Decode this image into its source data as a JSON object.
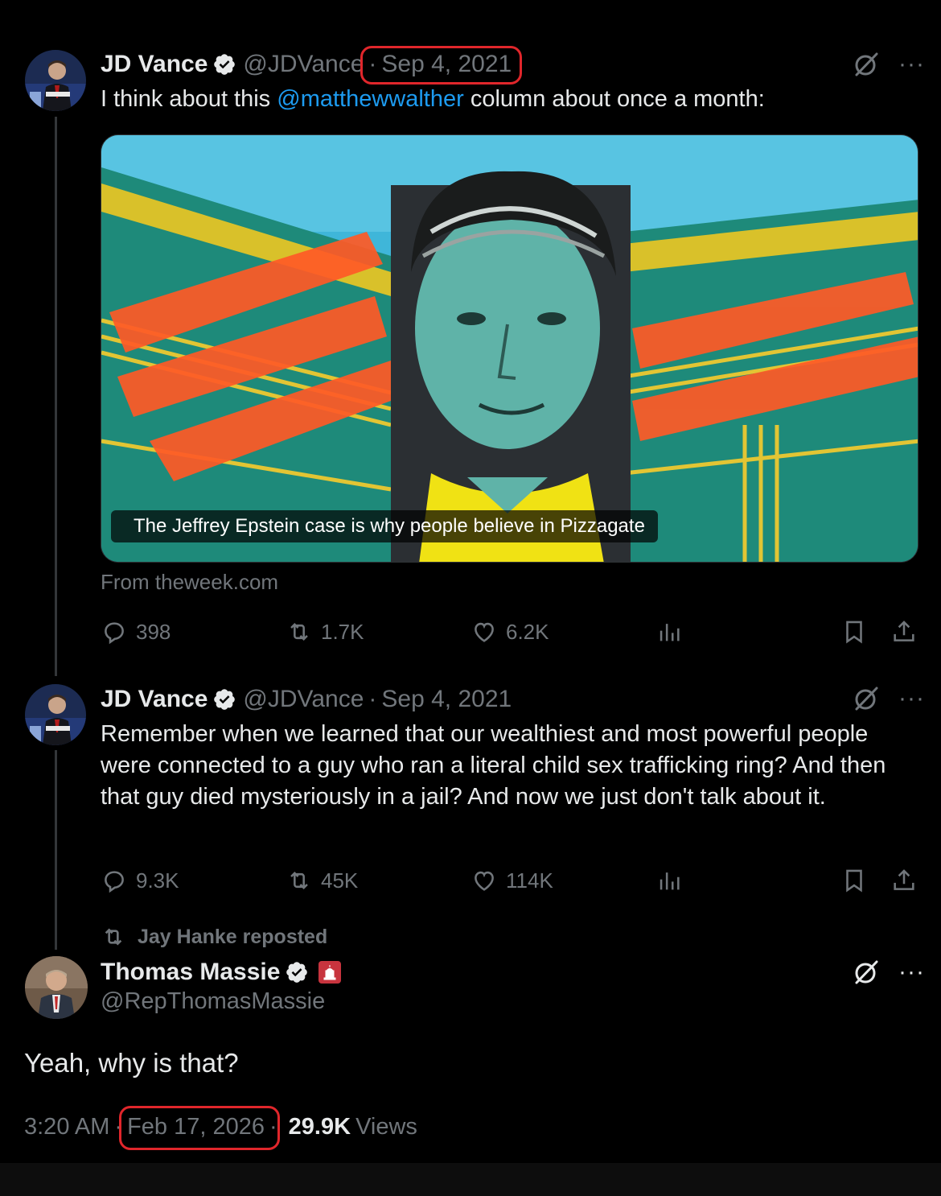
{
  "tweets": [
    {
      "name": "JD Vance",
      "handle": "@JDVance",
      "sep": "·",
      "date": "Sep 4, 2021",
      "text_before": "I think about this ",
      "mention": "@matthewwalther",
      "text_after": " column about once a month:",
      "card": {
        "caption": "The Jeffrey Epstein case is why people believe in Pizzagate",
        "source": "From theweek.com"
      },
      "stats": {
        "replies": "398",
        "reposts": "1.7K",
        "likes": "6.2K"
      }
    },
    {
      "name": "JD Vance",
      "handle": "@JDVance",
      "sep": "·",
      "date": "Sep 4, 2021",
      "text": "Remember when we learned that our wealthiest and most powerful people were connected to a guy who ran a literal child sex trafficking ring? And then that guy died mysteriously in a jail? And now we just don't talk about it.",
      "stats": {
        "replies": "9.3K",
        "reposts": "45K",
        "likes": "114K"
      }
    }
  ],
  "main_post": {
    "repost_label": "Jay Hanke reposted",
    "name": "Thomas Massie",
    "handle": "@RepThomasMassie",
    "text": "Yeah, why is that?",
    "time": "3:20 AM",
    "sep": "·",
    "date": "Feb 17, 2026",
    "views_count": "29.9K",
    "views_label": "Views"
  },
  "more_label": "···",
  "icons": [
    "verified-badge-icon",
    "grok-icon",
    "more-icon",
    "reply-icon",
    "repost-icon",
    "like-icon",
    "views-icon",
    "bookmark-icon",
    "share-icon",
    "capitol-badge-icon"
  ],
  "colors": {
    "accent": "#1d9bf0",
    "muted": "#71767b",
    "text": "#e7e9ea",
    "highlight": "#e0262b",
    "background": "#000000"
  }
}
